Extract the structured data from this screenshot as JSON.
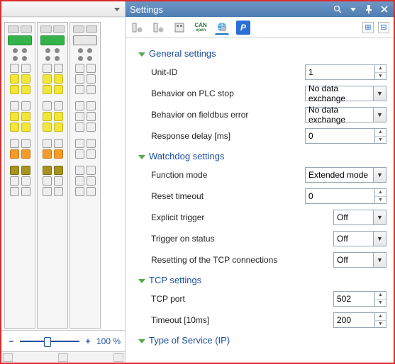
{
  "panel_title": "Settings",
  "zoom_label": "100 %",
  "toolbar_tabs": [
    {
      "name": "module-settings-icon"
    },
    {
      "name": "module-config-icon"
    },
    {
      "name": "io-icon"
    },
    {
      "name": "can-icon",
      "label": "CAN"
    },
    {
      "name": "globe-icon",
      "active": true
    },
    {
      "name": "p-icon",
      "label": "P"
    }
  ],
  "groups": {
    "general": {
      "title": "General settings",
      "rows": {
        "unit_id": {
          "label": "Unit-ID",
          "value": "1",
          "type": "num"
        },
        "plc_stop": {
          "label": "Behavior on PLC stop",
          "value": "No data exchange",
          "type": "sel"
        },
        "fb_error": {
          "label": "Behavior on fieldbus error",
          "value": "No data exchange",
          "type": "sel"
        },
        "resp_delay": {
          "label": "Response delay [ms]",
          "value": "0",
          "type": "num"
        }
      }
    },
    "watchdog": {
      "title": "Watchdog settings",
      "rows": {
        "func_mode": {
          "label": "Function mode",
          "value": "Extended mode",
          "type": "sel"
        },
        "reset_to": {
          "label": "Reset timeout",
          "value": "0",
          "type": "num"
        },
        "exp_trig": {
          "label": "Explicit trigger",
          "value": "Off",
          "type": "sel"
        },
        "trig_stat": {
          "label": "Trigger on status",
          "value": "Off",
          "type": "sel"
        },
        "reset_tcp": {
          "label": "Resetting of the TCP connections",
          "value": "Off",
          "type": "sel"
        }
      }
    },
    "tcp": {
      "title": "TCP settings",
      "rows": {
        "port": {
          "label": "TCP port",
          "value": "502",
          "type": "num"
        },
        "timeout": {
          "label": "Timeout [10ms]",
          "value": "200",
          "type": "num"
        }
      }
    },
    "tos": {
      "title": "Type of Service (IP)"
    }
  }
}
